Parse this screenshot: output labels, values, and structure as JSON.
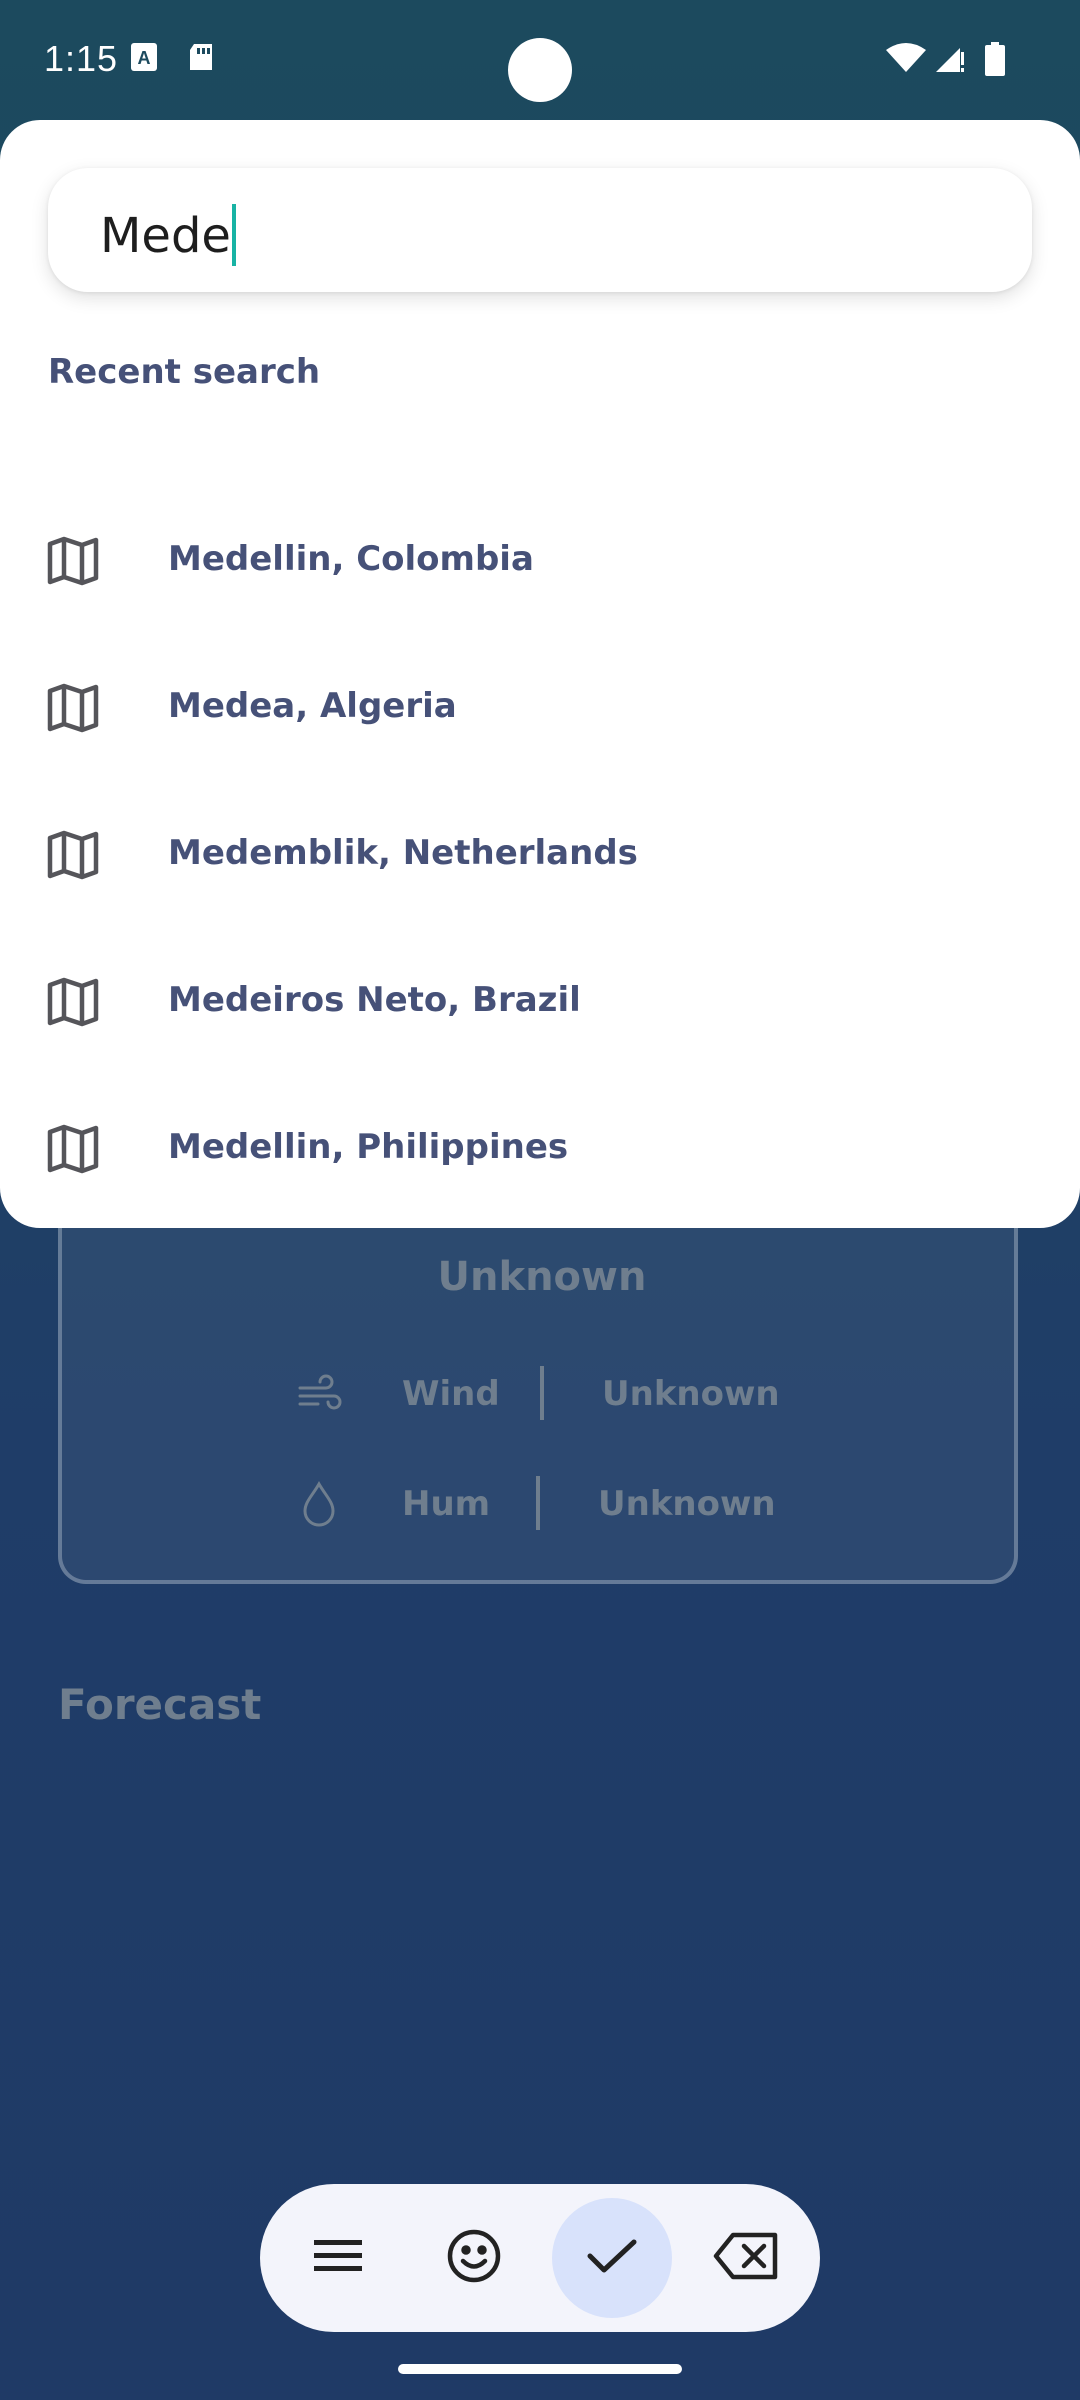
{
  "status_bar": {
    "time": "1:15"
  },
  "search": {
    "value": "Mede"
  },
  "recent": {
    "label": "Recent search",
    "items": [
      {
        "label": "Medellin, Colombia",
        "icon": "map-icon"
      },
      {
        "label": "Medea, Algeria",
        "icon": "map-icon"
      },
      {
        "label": "Medemblik, Netherlands",
        "icon": "map-icon"
      },
      {
        "label": "Medeiros Neto, Brazil",
        "icon": "map-icon"
      },
      {
        "label": "Medellin, Philippines",
        "icon": "map-icon"
      }
    ]
  },
  "background_card": {
    "condition": "Unknown",
    "wind_label": "Wind",
    "wind_value": "Unknown",
    "humidity_label": "Hum",
    "humidity_value": "Unknown"
  },
  "forecast": {
    "title": "Forecast"
  },
  "keyboard_toolbar": {
    "buttons": [
      "menu-icon",
      "emoji-icon",
      "check-icon",
      "backspace-icon"
    ]
  },
  "colors": {
    "accent_text": "#465178",
    "caret": "#18b3a4",
    "sheet": "#ffffff"
  }
}
